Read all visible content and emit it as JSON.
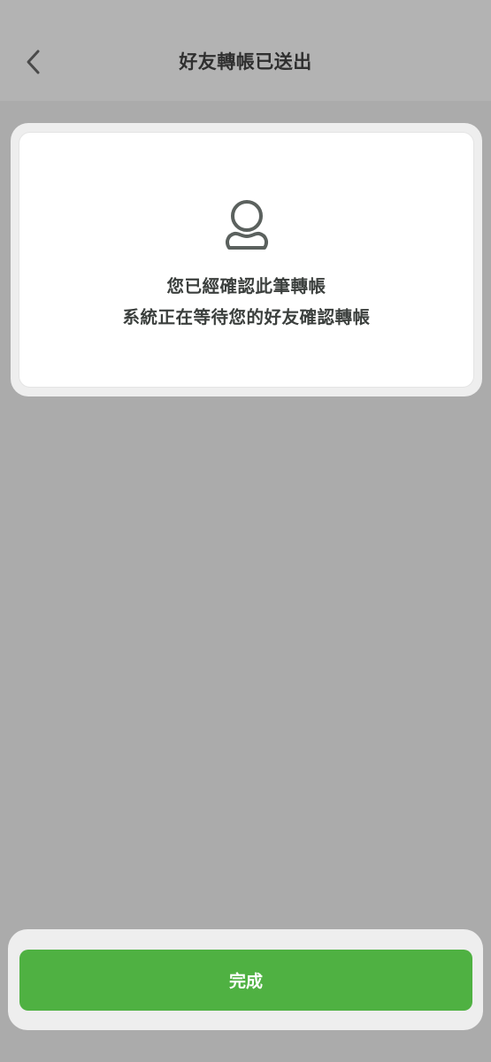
{
  "header": {
    "title": "好友轉帳已送出",
    "back_icon": "chevron-left-icon"
  },
  "card": {
    "icon": "person-icon",
    "line1": "您已經確認此筆轉帳",
    "line2": "系統正在等待您的好友確認轉帳"
  },
  "footer": {
    "done_label": "完成"
  },
  "colors": {
    "accent": "#4fb142",
    "background": "#ababab",
    "header_bg": "#b3b3b3",
    "text": "#2f2f2f"
  }
}
